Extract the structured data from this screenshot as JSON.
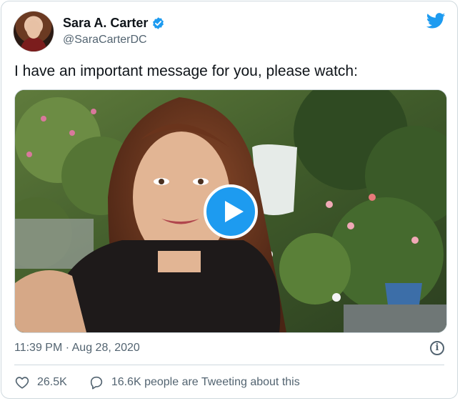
{
  "tweet": {
    "author": {
      "display_name": "Sara A. Carter",
      "handle": "@SaraCarterDC",
      "verified": true
    },
    "text": "I have an important message for you, please watch:",
    "timestamp": "11:39 PM · Aug 28, 2020",
    "media": {
      "type": "video",
      "play_icon": "play-icon"
    },
    "stats": {
      "likes": "26.5K",
      "discussion": "16.6K people are Tweeting about this"
    }
  },
  "icons": {
    "brand": "twitter-bird-icon",
    "verified": "verified-badge-icon",
    "info": "info-icon",
    "like": "heart-icon",
    "reply": "speech-bubble-icon"
  },
  "colors": {
    "brand": "#1d9bf0",
    "secondary_text": "#536471",
    "border": "#cfd9de"
  }
}
